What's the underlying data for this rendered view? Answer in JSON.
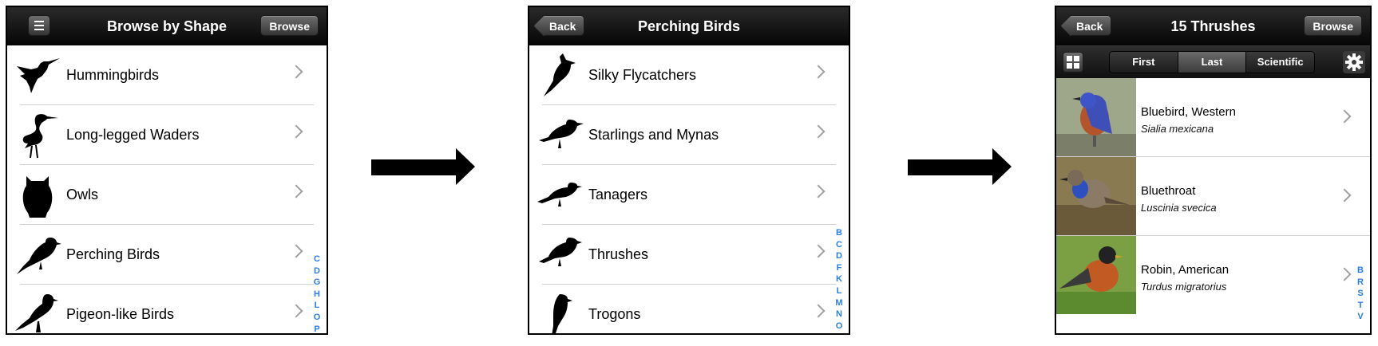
{
  "screen1": {
    "title": "Browse by Shape",
    "right_button": "Browse",
    "rows": [
      {
        "label": "Hummingbirds",
        "icon": "hummingbird-silhouette"
      },
      {
        "label": "Long-legged Waders",
        "icon": "heron-silhouette"
      },
      {
        "label": "Owls",
        "icon": "owl-silhouette"
      },
      {
        "label": "Perching Birds",
        "icon": "perching-bird-silhouette"
      },
      {
        "label": "Pigeon-like Birds",
        "icon": "pigeon-silhouette"
      }
    ],
    "index": [
      "C",
      "D",
      "G",
      "H",
      "L",
      "O",
      "P"
    ]
  },
  "screen2": {
    "title": "Perching Birds",
    "back_button": "Back",
    "rows": [
      {
        "label": "Silky Flycatchers",
        "icon": "flycatcher-silhouette"
      },
      {
        "label": "Starlings and Mynas",
        "icon": "starling-silhouette"
      },
      {
        "label": "Tanagers",
        "icon": "tanager-silhouette"
      },
      {
        "label": "Thrushes",
        "icon": "thrush-silhouette"
      },
      {
        "label": "Trogons",
        "icon": "trogon-silhouette"
      }
    ],
    "index": [
      "B",
      "C",
      "D",
      "F",
      "K",
      "L",
      "M",
      "N",
      "O"
    ]
  },
  "screen3": {
    "title": "15 Thrushes",
    "back_button": "Back",
    "right_button": "Browse",
    "segments": [
      "First",
      "Last",
      "Scientific"
    ],
    "selected_segment": "Last",
    "rows": [
      {
        "name": "Bluebird, Western",
        "scientific": "Sialia mexicana"
      },
      {
        "name": "Bluethroat",
        "scientific": "Luscinia svecica"
      },
      {
        "name": "Robin, American",
        "scientific": "Turdus migratorius"
      }
    ],
    "index": [
      "B",
      "R",
      "S",
      "T",
      "V"
    ]
  },
  "colors": {
    "index_blue": "#2a7ee6",
    "navbar": "#0a0a0a"
  }
}
